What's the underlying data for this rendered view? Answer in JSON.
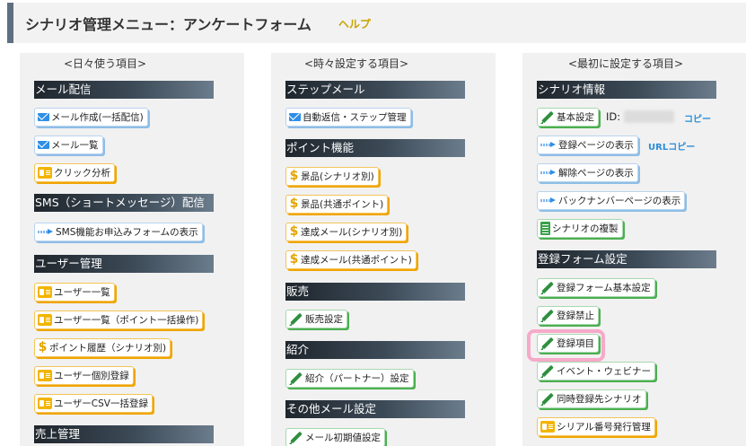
{
  "header": {
    "title": "シナリオ管理メニュー：アンケートフォーム",
    "help": "ヘルプ"
  },
  "columns": [
    {
      "heading": "<日々使う項目>",
      "sections": [
        {
          "title": "メール配信",
          "items": [
            "メール作成(一括配信)",
            "メール一覧",
            "クリック分析"
          ]
        },
        {
          "title": "SMS（ショートメッセージ）配信",
          "items": [
            "SMS機能お申込みフォームの表示"
          ]
        },
        {
          "title": "ユーザー管理",
          "items": [
            "ユーザー一覧",
            "ユーザー一覧（ポイント一括操作)",
            "ポイント履歴（シナリオ別)",
            "ユーザー個別登録",
            "ユーザーCSV一括登録"
          ]
        },
        {
          "title": "売上管理",
          "items": []
        }
      ]
    },
    {
      "heading": "<時々設定する項目>",
      "sections": [
        {
          "title": "ステップメール",
          "items": [
            "自動返信・ステップ管理"
          ]
        },
        {
          "title": "ポイント機能",
          "items": [
            "景品(シナリオ別)",
            "景品(共通ポイント)",
            "達成メール(シナリオ別)",
            "達成メール(共通ポイント)"
          ]
        },
        {
          "title": "販売",
          "items": [
            "販売設定"
          ]
        },
        {
          "title": "紹介",
          "items": [
            "紹介（パートナー）設定"
          ]
        },
        {
          "title": "その他メール設定",
          "items": [
            "メール初期値設定"
          ]
        }
      ]
    },
    {
      "heading": "<最初に設定する項目>",
      "sections": [
        {
          "title": "シナリオ情報",
          "items": [
            "基本設定",
            "登録ページの表示",
            "解除ページの表示",
            "バックナンバーページの表示",
            "シナリオの複製"
          ]
        },
        {
          "title": "登録フォーム設定",
          "items": [
            "登録フォーム基本設定",
            "登録禁止",
            "登録項目",
            "イベント・ウェビナー",
            "同時登録先シナリオ",
            "シリアル番号発行管理"
          ]
        }
      ]
    }
  ],
  "scenario_info": {
    "id_label": "ID:",
    "copy": "コピー",
    "url_copy": "URLコピー"
  },
  "colors": {
    "header_accent": "#5e6f80",
    "help_text": "#c9a400",
    "link": "#2a8ed8",
    "highlight": "#f6a9c8"
  },
  "icons": {
    "mail": "mail-icon",
    "arrow": "arrow-right-icon",
    "card": "id-card-icon",
    "dollar": "dollar-icon",
    "pencil": "pencil-icon",
    "doc": "document-icon"
  }
}
